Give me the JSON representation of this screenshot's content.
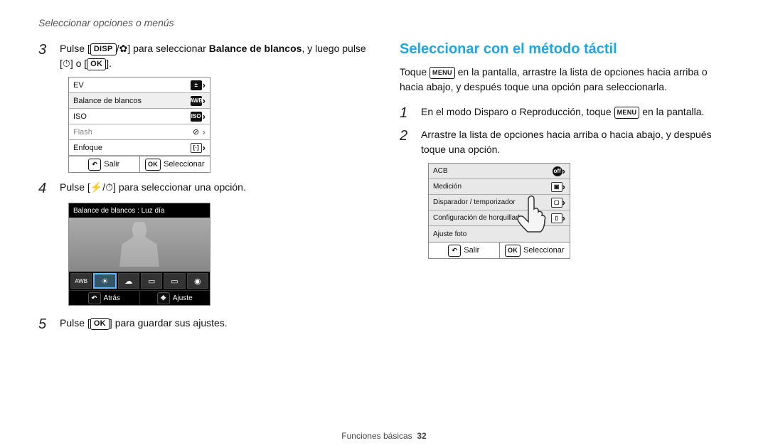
{
  "breadcrumb": "Seleccionar opciones o menús",
  "heading_right": "Seleccionar con el método táctil",
  "keys": {
    "disp": "DISP",
    "ok": "OK",
    "menu": "MENU"
  },
  "glyphs": {
    "macro": "✿",
    "flash": "⚡",
    "timer": "⏱"
  },
  "steps_left": {
    "s3": {
      "num": "3",
      "text1": "Pulse [",
      "text2": "/",
      "text3": "] para seleccionar ",
      "bold": "Balance de blancos",
      "text4": ", y luego pulse [",
      "text5": "] o [",
      "text6": "]."
    },
    "s4": {
      "num": "4",
      "text1": "Pulse [",
      "text2": "/",
      "text3": "] para seleccionar una opción."
    },
    "s5": {
      "num": "5",
      "text1": "Pulse [",
      "text2": "] para guardar sus ajustes."
    }
  },
  "right_intro": {
    "p1a": "Toque ",
    "p1b": " en la pantalla, arrastre la lista de opciones hacia arriba o hacia abajo, y después toque una opción para seleccionarla."
  },
  "steps_right": {
    "s1": {
      "num": "1",
      "text1": "En el modo Disparo o Reproducción, toque ",
      "text2": " en la pantalla."
    },
    "s2": {
      "num": "2",
      "text": "Arrastre la lista de opciones hacia arriba o hacia abajo, y después toque una opción."
    }
  },
  "fig1": {
    "rows": [
      {
        "label": "EV"
      },
      {
        "label": "Balance de blancos",
        "hl": true,
        "icon": "AWB"
      },
      {
        "label": "ISO",
        "icon": "ISO"
      },
      {
        "label": "Flash",
        "dim": true
      },
      {
        "label": "Enfoque"
      }
    ],
    "footer_left": "Salir",
    "footer_right": "Seleccionar"
  },
  "fig2": {
    "title": "Balance de blancos : Luz día",
    "footer_left": "Atrás",
    "footer_right": "Ajuste",
    "thumb_selected": 1
  },
  "fig3": {
    "rows": [
      {
        "label": "ACB"
      },
      {
        "label": "Medición"
      },
      {
        "label": "Disparador / temporizador"
      },
      {
        "label": "Configuración de horquillado"
      },
      {
        "label": "Ajuste foto"
      }
    ],
    "footer_left": "Salir",
    "footer_right": "Seleccionar"
  },
  "footer": {
    "section": "Funciones básicas",
    "page": "32"
  }
}
